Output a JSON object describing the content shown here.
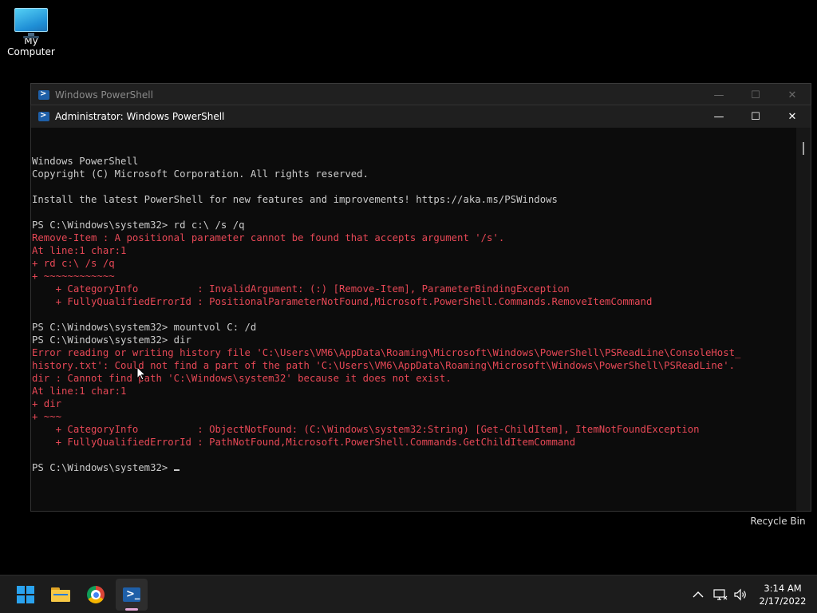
{
  "desktop": {
    "my_computer_label": "My Computer",
    "recycle_bin_label": "Recycle Bin"
  },
  "back_window": {
    "title": "Windows PowerShell",
    "minimize": "—",
    "maximize": "☐",
    "close": "✕"
  },
  "main_window": {
    "title": "Administrator: Windows PowerShell",
    "minimize": "—",
    "maximize": "☐",
    "close": "✕"
  },
  "terminal": {
    "lines": [
      {
        "t": "Windows PowerShell",
        "err": false
      },
      {
        "t": "Copyright (C) Microsoft Corporation. All rights reserved.",
        "err": false
      },
      {
        "t": "",
        "err": false
      },
      {
        "t": "Install the latest PowerShell for new features and improvements! https://aka.ms/PSWindows",
        "err": false
      },
      {
        "t": "",
        "err": false
      },
      {
        "t": "PS C:\\Windows\\system32> rd c:\\ /s /q",
        "err": false
      },
      {
        "t": "Remove-Item : A positional parameter cannot be found that accepts argument '/s'.",
        "err": true
      },
      {
        "t": "At line:1 char:1",
        "err": true
      },
      {
        "t": "+ rd c:\\ /s /q",
        "err": true
      },
      {
        "t": "+ ~~~~~~~~~~~~",
        "err": true
      },
      {
        "t": "    + CategoryInfo          : InvalidArgument: (:) [Remove-Item], ParameterBindingException",
        "err": true
      },
      {
        "t": "    + FullyQualifiedErrorId : PositionalParameterNotFound,Microsoft.PowerShell.Commands.RemoveItemCommand",
        "err": true
      },
      {
        "t": "",
        "err": false
      },
      {
        "t": "PS C:\\Windows\\system32> mountvol C: /d",
        "err": false
      },
      {
        "t": "PS C:\\Windows\\system32> dir",
        "err": false
      },
      {
        "t": "Error reading or writing history file 'C:\\Users\\VM6\\AppData\\Roaming\\Microsoft\\Windows\\PowerShell\\PSReadLine\\ConsoleHost_",
        "err": true
      },
      {
        "t": "history.txt': Could not find a part of the path 'C:\\Users\\VM6\\AppData\\Roaming\\Microsoft\\Windows\\PowerShell\\PSReadLine'.",
        "err": true
      },
      {
        "t": "dir : Cannot find path 'C:\\Windows\\system32' because it does not exist.",
        "err": true
      },
      {
        "t": "At line:1 char:1",
        "err": true
      },
      {
        "t": "+ dir",
        "err": true
      },
      {
        "t": "+ ~~~",
        "err": true
      },
      {
        "t": "    + CategoryInfo          : ObjectNotFound: (C:\\Windows\\system32:String) [Get-ChildItem], ItemNotFoundException",
        "err": true
      },
      {
        "t": "    + FullyQualifiedErrorId : PathNotFound,Microsoft.PowerShell.Commands.GetChildItemCommand",
        "err": true
      },
      {
        "t": "",
        "err": false
      }
    ],
    "prompt": "PS C:\\Windows\\system32> "
  },
  "taskbar": {
    "clock_time": "3:14 AM",
    "clock_date": "2/17/2022",
    "icons": {
      "start": "windows-start-icon",
      "explorer": "file-explorer-icon",
      "chrome": "chrome-icon",
      "powershell": "powershell-icon",
      "tray_chevron": "chevron-up-icon",
      "network": "network-icon",
      "volume": "volume-icon"
    },
    "accent": "#2aa3ef"
  },
  "colors": {
    "terminal_bg": "#0c0c0c",
    "terminal_text": "#cccccc",
    "error_text": "#e74856"
  }
}
